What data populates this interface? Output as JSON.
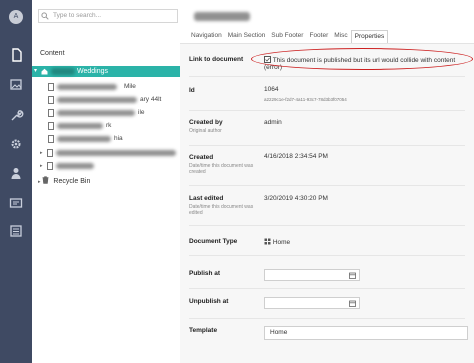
{
  "rail": {
    "avatar_letter": "A"
  },
  "search": {
    "placeholder": "Type to search..."
  },
  "tree": {
    "section_title": "Content",
    "root_label": "Weddings",
    "children": [
      "Mile",
      "ary 44lt",
      "ile",
      "rk",
      "hia"
    ],
    "recycle_bin": "Recycle Bin"
  },
  "tabs": [
    "Navigation",
    "Main Section",
    "Sub Footer",
    "Footer",
    "Misc",
    "Properties"
  ],
  "properties": {
    "link_label": "Link to document",
    "link_warning": "This document is published but its url would collide with content (error)",
    "id_label": "Id",
    "id_value": "1064",
    "id_guid": "a2229c1e-f2d7-4a11-93c7-78d3b3f07054",
    "created_by_label": "Created by",
    "created_by_sub": "Original author",
    "created_by_value": "admin",
    "created_label": "Created",
    "created_sub": "Date/time this document was created",
    "created_value": "4/16/2018 2:34:54 PM",
    "last_edited_label": "Last edited",
    "last_edited_sub": "Date/time this document was edited",
    "last_edited_value": "3/20/2019 4:30:20 PM",
    "doc_type_label": "Document Type",
    "doc_type_value": "Home",
    "publish_at_label": "Publish at",
    "unpublish_at_label": "Unpublish at",
    "template_label": "Template",
    "template_value": "Home"
  },
  "colors": {
    "rail": "#3f4a63",
    "tree_selected": "#2bb3a8",
    "highlight_oval": "#cc1f1f"
  }
}
